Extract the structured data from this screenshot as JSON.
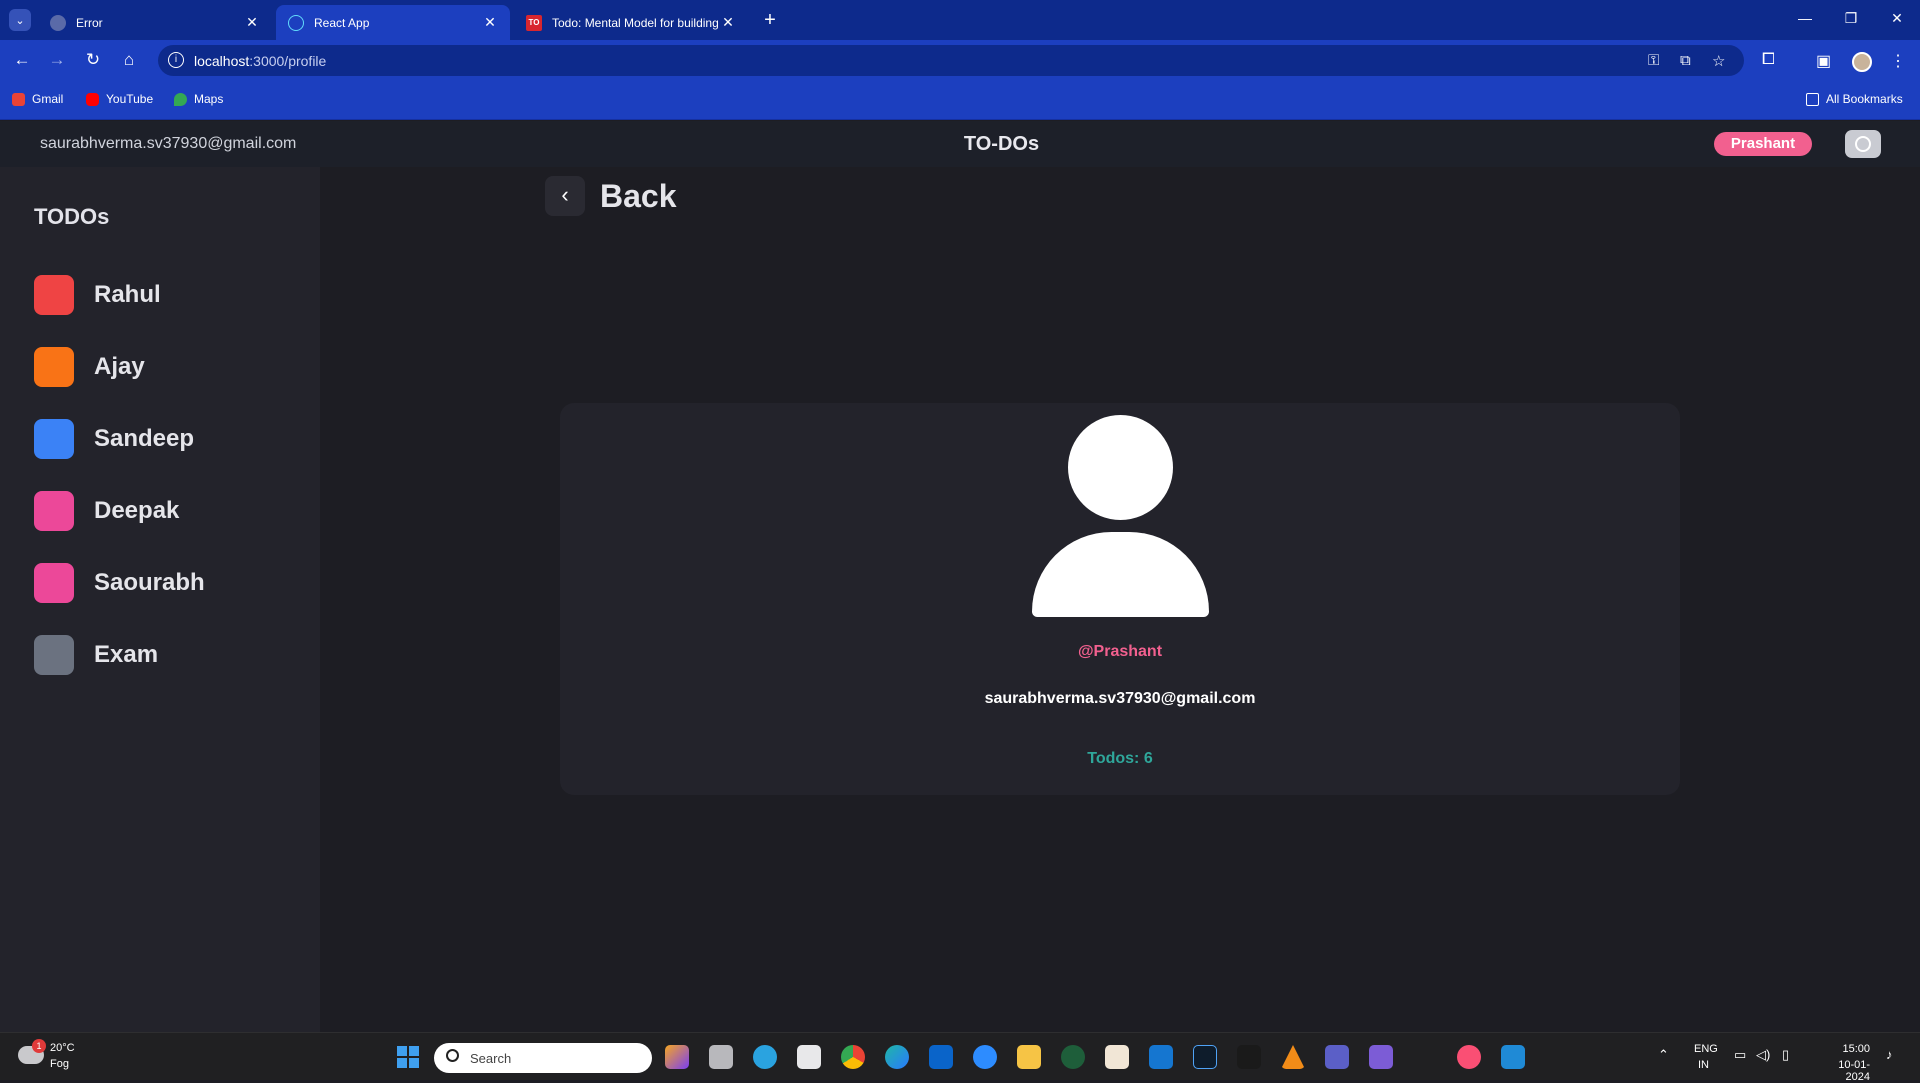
{
  "browser": {
    "tabs": [
      {
        "title": "Error",
        "active": false
      },
      {
        "title": "React App",
        "active": true
      },
      {
        "title": "Todo: Mental Model for building",
        "active": false,
        "favicon_text": "TO"
      }
    ],
    "url_host": "localhost",
    "url_path": ":3000/profile",
    "bookmarks": [
      "Gmail",
      "YouTube",
      "Maps"
    ],
    "all_bookmarks": "All Bookmarks"
  },
  "header": {
    "email": "saurabhverma.sv37930@gmail.com",
    "title": "TO-DOs",
    "user_button": "Prashant"
  },
  "sidebar": {
    "title": "TODOs",
    "items": [
      {
        "label": "Rahul",
        "color": "#ef4444"
      },
      {
        "label": "Ajay",
        "color": "#f97316"
      },
      {
        "label": "Sandeep",
        "color": "#3b82f6"
      },
      {
        "label": "Deepak",
        "color": "#ec4899"
      },
      {
        "label": "Saourabh",
        "color": "#ec4899"
      },
      {
        "label": "Exam",
        "color": "#6b7280"
      }
    ]
  },
  "main": {
    "back_label": "Back",
    "profile": {
      "handle": "@Prashant",
      "email": "saurabhverma.sv37930@gmail.com",
      "todos": "Todos: 6"
    }
  },
  "taskbar": {
    "weather_temp": "20°C",
    "weather_cond": "Fog",
    "weather_badge": "1",
    "search_placeholder": "Search",
    "lang_top": "ENG",
    "lang_bottom": "IN",
    "time": "15:00",
    "date": "10-01-2024"
  },
  "colors": {
    "accent_pink": "#f2608f",
    "accent_teal": "#2fa69a",
    "browser_blue": "#1c3fbf"
  }
}
